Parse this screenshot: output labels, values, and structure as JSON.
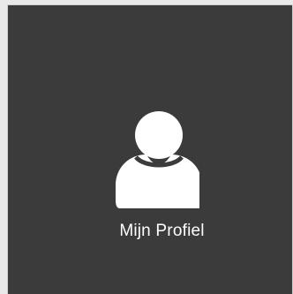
{
  "tile": {
    "label": "Mijn Profiel",
    "icon": "user-profile-icon",
    "background_color": "#3b3b3b",
    "text_color": "#ffffff"
  }
}
